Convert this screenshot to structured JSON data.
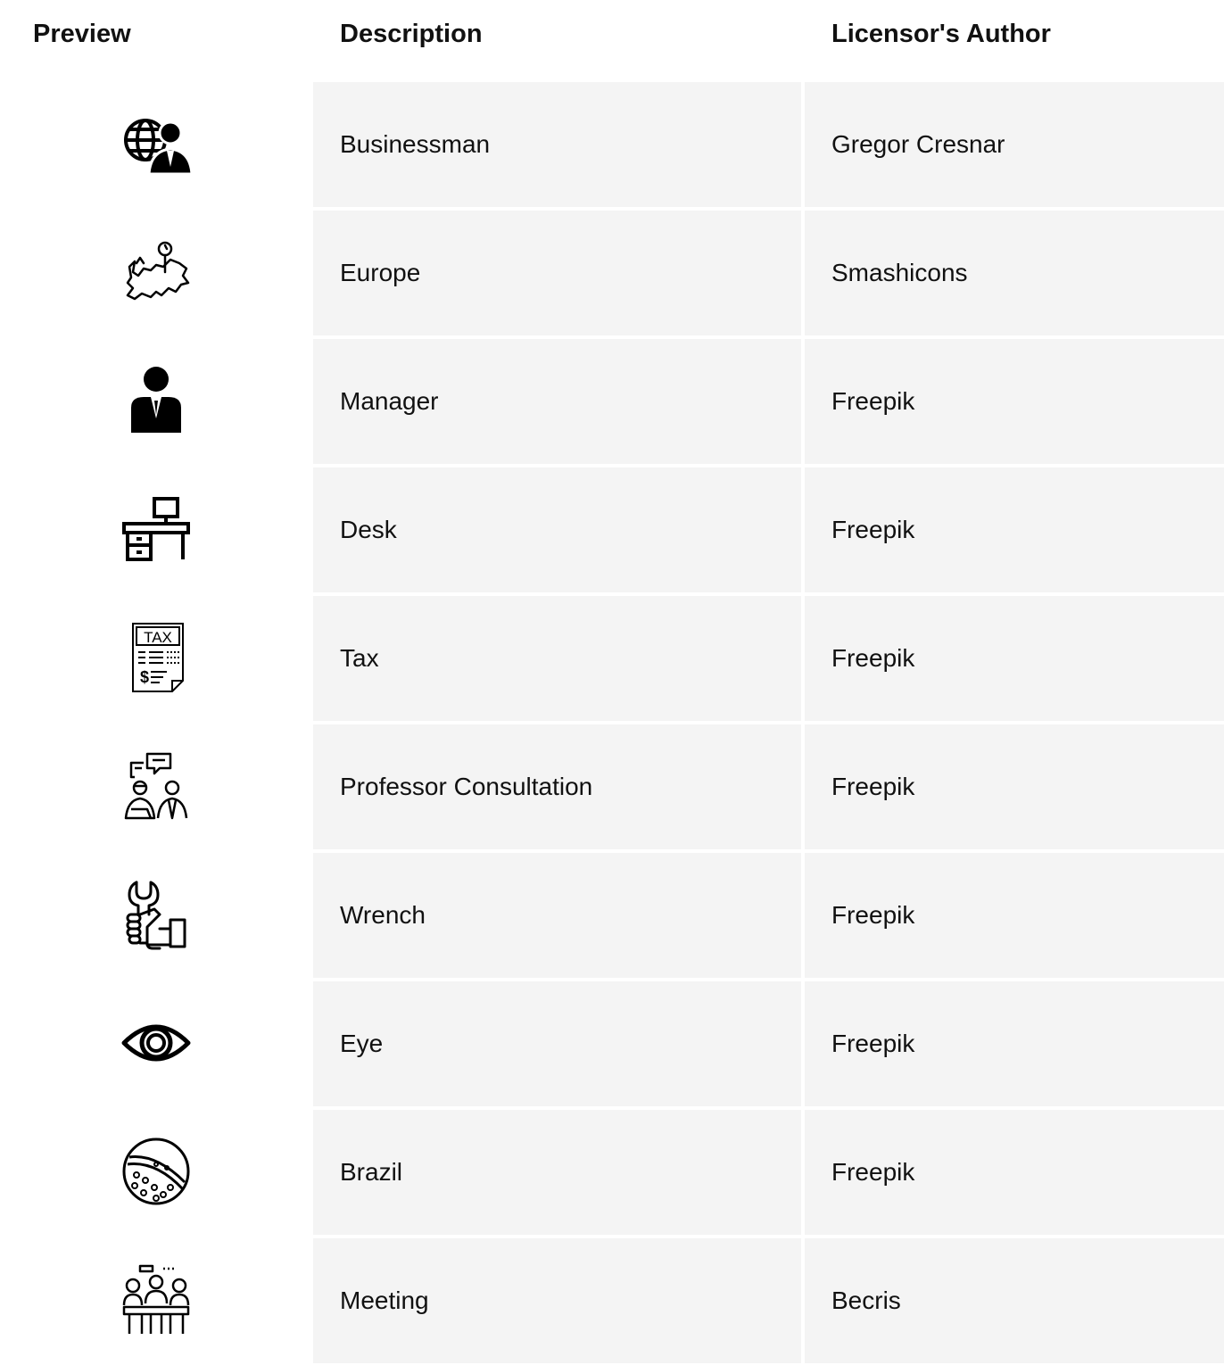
{
  "header": {
    "preview": "Preview",
    "description": "Description",
    "author": "Licensor's Author"
  },
  "rows": [
    {
      "icon": "globe-businessman-icon",
      "description": "Businessman",
      "author": "Gregor Cresnar"
    },
    {
      "icon": "europe-map-pin-icon",
      "description": "Europe",
      "author": "Smashicons"
    },
    {
      "icon": "manager-icon",
      "description": "Manager",
      "author": "Freepik"
    },
    {
      "icon": "desk-computer-icon",
      "description": "Desk",
      "author": "Freepik"
    },
    {
      "icon": "tax-document-icon",
      "description": "Tax",
      "author": "Freepik",
      "icon_text": "TAX"
    },
    {
      "icon": "professor-consultation-icon",
      "description": "Professor Consultation",
      "author": "Freepik"
    },
    {
      "icon": "wrench-hand-icon",
      "description": "Wrench",
      "author": "Freepik"
    },
    {
      "icon": "eye-icon",
      "description": "Eye",
      "author": "Freepik"
    },
    {
      "icon": "brazil-ball-icon",
      "description": "Brazil",
      "author": "Freepik"
    },
    {
      "icon": "meeting-icon",
      "description": "Meeting",
      "author": "Becris"
    }
  ]
}
